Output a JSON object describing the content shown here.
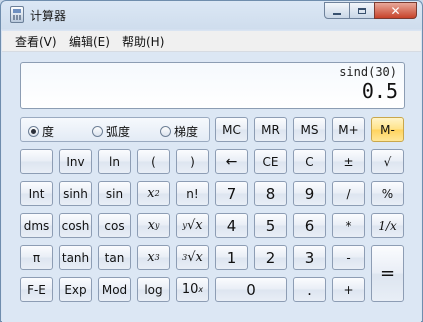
{
  "window": {
    "title": "计算器"
  },
  "menu": [
    "查看(V)",
    "编辑(E)",
    "帮助(H)"
  ],
  "display": {
    "expression": "sind(30)",
    "result": "0.5"
  },
  "angle_modes": [
    {
      "label": "度",
      "selected": true
    },
    {
      "label": "弧度",
      "selected": false
    },
    {
      "label": "梯度",
      "selected": false
    }
  ],
  "memory_keys": [
    "MC",
    "MR",
    "MS",
    "M+",
    "M-"
  ],
  "keys": {
    "r1": [
      "",
      "Inv",
      "ln",
      "(",
      ")",
      "←",
      "CE",
      "C",
      "±",
      "√"
    ],
    "r2": [
      "Int",
      "sinh",
      "sin",
      "x",
      "n!",
      "7",
      "8",
      "9",
      "/",
      "%"
    ],
    "r3": [
      "dms",
      "cosh",
      "cos",
      "x",
      "x",
      "4",
      "5",
      "6",
      "*",
      "1/x"
    ],
    "r4": [
      "π",
      "tanh",
      "tan",
      "x",
      "x",
      "1",
      "2",
      "3",
      "-",
      "="
    ],
    "r5": [
      "F-E",
      "Exp",
      "Mod",
      "log",
      "10",
      "0",
      ".",
      "+"
    ],
    "superscripts": {
      "x2": "2",
      "xy": "y",
      "yroot": "y",
      "x3": "3",
      "cuberoot": "3",
      "tenx": "x"
    },
    "root_glyph": "√"
  }
}
